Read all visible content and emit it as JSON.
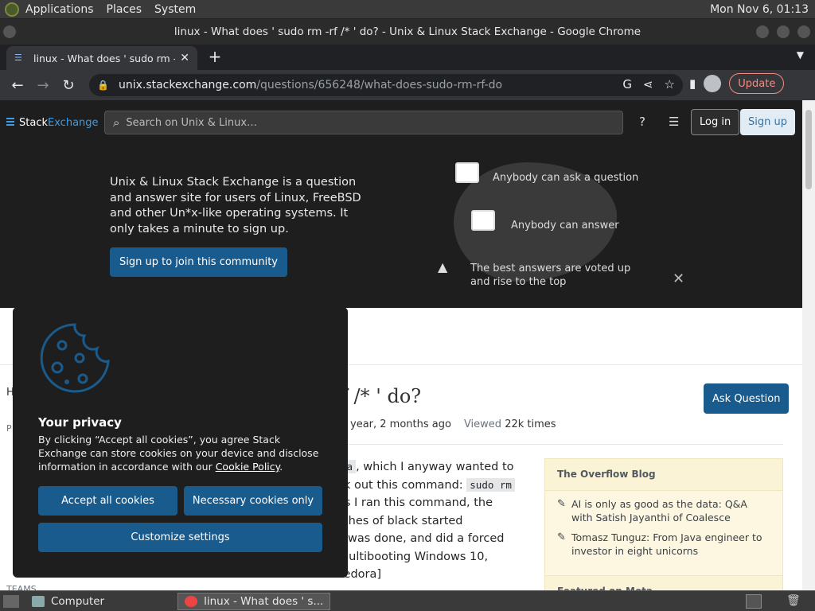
{
  "os_panel": {
    "menus": [
      "Applications",
      "Places",
      "System"
    ],
    "clock": "Mon Nov 6, 01:13"
  },
  "window": {
    "title": "linux - What does ' sudo rm -rf /* ' do? - Unix & Linux Stack Exchange - Google Chrome"
  },
  "tab": {
    "title": "linux - What does ' sudo rm -rf"
  },
  "address": {
    "host": "unix.stackexchange.com",
    "path": "/questions/656248/what-does-sudo-rm-rf-do"
  },
  "toolbar": {
    "update_label": "Update"
  },
  "se_header": {
    "logo_part1": "Stack",
    "logo_part2": "Exchange",
    "search_placeholder": "Search on Unix & Linux…",
    "login_label": "Log in",
    "signup_label": "Sign up"
  },
  "hero": {
    "text": "Unix & Linux Stack Exchange is a question and answer site for users of Linux, FreeBSD and other Un*x-like operating systems. It only takes a minute to sign up.",
    "cta": "Sign up to join this community",
    "feature1": "Anybody can ask a question",
    "feature2": "Anybody can answer",
    "feature3": "The best answers are voted up and rise to the top"
  },
  "question": {
    "title_fragment": "f /* ' do?",
    "asked_fragment": "year, 2 months ago",
    "viewed_label": "Viewed",
    "viewed_value": "22k times",
    "ask_button": "Ask Question",
    "body_lines": [
      "ra",
      ", which I anyway wanted to",
      "ck out this command: ",
      "sudo rm",
      "as I ran this command, the",
      "tches of black started",
      "k was done, and did a forced",
      " multibooting Windows 10,",
      "Fedora]"
    ]
  },
  "left_nav": {
    "home_fragment": "H",
    "public_fragment": "P",
    "teams": "TEAMS"
  },
  "blog": {
    "header": "The Overflow Blog",
    "items": [
      "AI is only as good as the data: Q&A with Satish Jayanthi of Coalesce",
      "Tomasz Tunguz: From Java engineer to investor in eight unicorns"
    ],
    "meta_header": "Featured on Meta"
  },
  "cookie": {
    "title": "Your privacy",
    "text_before": "By clicking “Accept all cookies”, you agree Stack Exchange can store cookies on your device and disclose information in accordance with our ",
    "policy_link": "Cookie Policy",
    "text_after": ".",
    "accept_all": "Accept all cookies",
    "necessary_only": "Necessary cookies only",
    "customize": "Customize settings"
  },
  "taskbar": {
    "items": [
      "Computer",
      "linux - What does ' s..."
    ]
  },
  "colors": {
    "se_blue": "#1a5b8d",
    "chrome_dark": "#35363a"
  }
}
